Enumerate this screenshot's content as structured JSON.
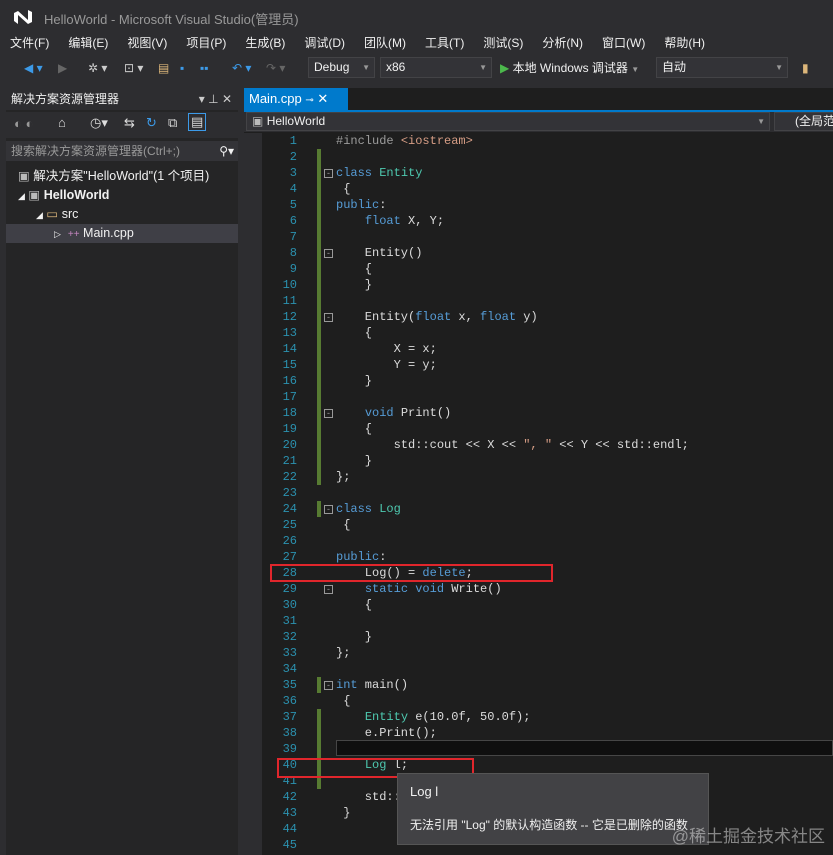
{
  "window": {
    "title": "HelloWorld - Microsoft Visual Studio(管理员)"
  },
  "menu": [
    "文件(F)",
    "编辑(E)",
    "视图(V)",
    "项目(P)",
    "生成(B)",
    "调试(D)",
    "团队(M)",
    "工具(T)",
    "测试(S)",
    "分析(N)",
    "窗口(W)",
    "帮助(H)"
  ],
  "toolbar": {
    "config": "Debug",
    "platform": "x86",
    "run_label": "本地 Windows 调试器",
    "run_mode": "自动"
  },
  "solution_explorer": {
    "title": "解决方案资源管理器",
    "search_placeholder": "搜索解决方案资源管理器(Ctrl+;)",
    "tree": [
      {
        "label": "解决方案\"HelloWorld\"(1 个项目)"
      },
      {
        "label": "HelloWorld"
      },
      {
        "label": "src"
      },
      {
        "label": "Main.cpp"
      }
    ]
  },
  "editor": {
    "tab": "Main.cpp",
    "scope_left": "HelloWorld",
    "scope_right": "(全局范",
    "lines": [
      [
        [
          "#include ",
          "pp"
        ],
        [
          "<iostream>",
          "str"
        ]
      ],
      [],
      [
        [
          "class ",
          "kw"
        ],
        [
          "Entity",
          "ty"
        ]
      ],
      [
        [
          " {",
          "tx"
        ]
      ],
      [
        [
          "public",
          "kw"
        ],
        [
          ":",
          "tx"
        ]
      ],
      [
        [
          "    ",
          "tx"
        ],
        [
          "float",
          "kw"
        ],
        [
          " X, Y;",
          "tx"
        ]
      ],
      [],
      [
        [
          "    Entity()",
          "tx"
        ]
      ],
      [
        [
          "    {",
          "tx"
        ]
      ],
      [
        [
          "    }",
          "tx"
        ]
      ],
      [],
      [
        [
          "    Entity(",
          "tx"
        ],
        [
          "float",
          "kw"
        ],
        [
          " x, ",
          "tx"
        ],
        [
          "float",
          "kw"
        ],
        [
          " y)",
          "tx"
        ]
      ],
      [
        [
          "    {",
          "tx"
        ]
      ],
      [
        [
          "        X = x;",
          "tx"
        ]
      ],
      [
        [
          "        Y = y;",
          "tx"
        ]
      ],
      [
        [
          "    }",
          "tx"
        ]
      ],
      [],
      [
        [
          "    ",
          "tx"
        ],
        [
          "void",
          "kw"
        ],
        [
          " Print()",
          "tx"
        ]
      ],
      [
        [
          "    {",
          "tx"
        ]
      ],
      [
        [
          "        std::cout << X << ",
          "tx"
        ],
        [
          "\", \"",
          "str"
        ],
        [
          " << Y << std::endl;",
          "tx"
        ]
      ],
      [
        [
          "    }",
          "tx"
        ]
      ],
      [
        [
          "};",
          "tx"
        ]
      ],
      [],
      [
        [
          "class ",
          "kw"
        ],
        [
          "Log",
          "ty"
        ]
      ],
      [
        [
          " {",
          "tx"
        ]
      ],
      [],
      [
        [
          "public",
          "kw"
        ],
        [
          ":",
          "tx"
        ]
      ],
      [
        [
          "    Log() = ",
          "tx"
        ],
        [
          "delete",
          "kw"
        ],
        [
          ";",
          "tx"
        ]
      ],
      [
        [
          "    ",
          "tx"
        ],
        [
          "static void",
          "kw"
        ],
        [
          " Write()",
          "tx"
        ]
      ],
      [
        [
          "    {",
          "tx"
        ]
      ],
      [],
      [
        [
          "    }",
          "tx"
        ]
      ],
      [
        [
          "};",
          "tx"
        ]
      ],
      [],
      [
        [
          "int",
          "kw"
        ],
        [
          " main()",
          "tx"
        ]
      ],
      [
        [
          " {",
          "tx"
        ]
      ],
      [
        [
          "    ",
          "tx"
        ],
        [
          "Entity",
          "ty"
        ],
        [
          " e(10.0f, 50.0f);",
          "tx"
        ]
      ],
      [
        [
          "    e.Print();",
          "tx"
        ]
      ],
      [],
      [
        [
          "    ",
          "tx"
        ],
        [
          "Log",
          "ty"
        ],
        [
          " l;",
          "tx"
        ]
      ],
      [],
      [
        [
          "    std::",
          "tx"
        ]
      ],
      [
        [
          " }",
          "tx"
        ]
      ],
      [],
      []
    ]
  },
  "tooltip": {
    "title": "Log l",
    "message": "无法引用 \"Log\" 的默认构造函数 -- 它是已删除的函数"
  },
  "watermark": "@稀土掘金技术社区"
}
